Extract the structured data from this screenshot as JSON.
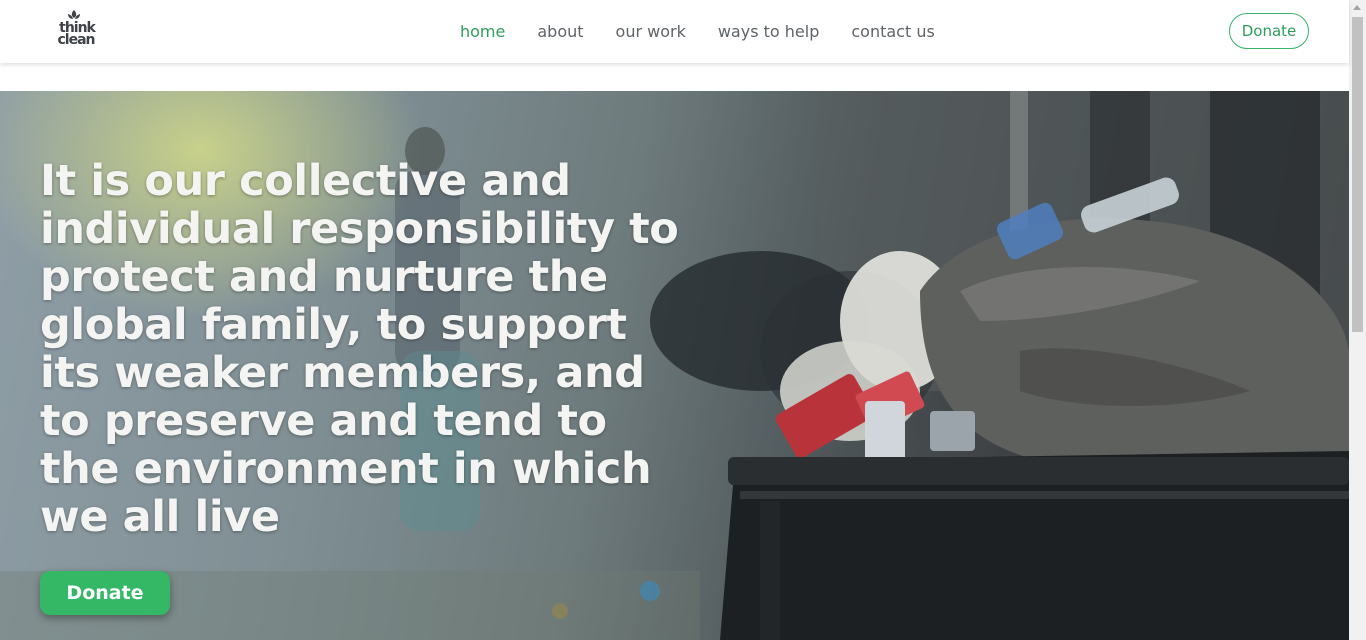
{
  "brand": {
    "logo_text_top": "think",
    "logo_text_bottom": "clean",
    "logo_icon": "leaf-icon"
  },
  "nav": {
    "links": [
      {
        "label": "home",
        "active": true
      },
      {
        "label": "about",
        "active": false
      },
      {
        "label": "our work",
        "active": false
      },
      {
        "label": "ways to help",
        "active": false
      },
      {
        "label": "contact us",
        "active": false
      }
    ],
    "donate_label": "Donate"
  },
  "hero": {
    "quote": "It is our collective and individual responsibility to protect and nurture the global family, to support its weaker members, and to preserve and tend to the environment in which we all live",
    "donate_label": "Donate"
  },
  "colors": {
    "accent_green": "#35b866",
    "nav_active": "#2f9e5c",
    "nav_text": "#5f6469"
  }
}
